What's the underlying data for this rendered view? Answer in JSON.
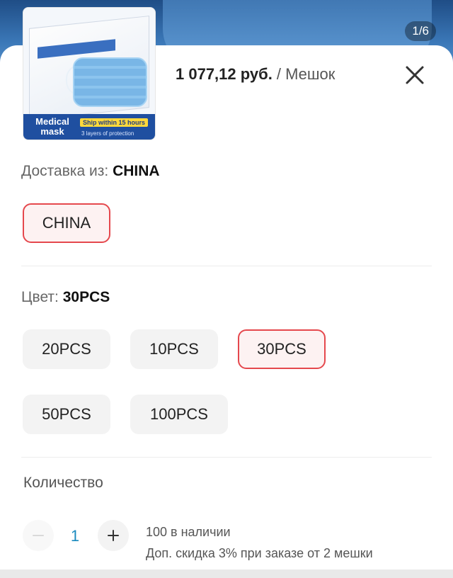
{
  "gallery": {
    "counter": "1/6"
  },
  "product": {
    "thumbnail": {
      "box_text": "一次性使用医用口罩",
      "medical_mask": "Medical mask",
      "ship_badge": "Ship within 15 hours",
      "layers": "3 layers of protection"
    },
    "price": "1 077,12 руб.",
    "unit": "/ Мешок"
  },
  "delivery": {
    "label": "Доставка из:",
    "selected": "CHINA",
    "options": [
      "CHINA"
    ]
  },
  "color": {
    "label": "Цвет:",
    "selected": "30PCS",
    "options": [
      "20PCS",
      "10PCS",
      "30PCS",
      "50PCS",
      "100PCS"
    ]
  },
  "quantity": {
    "label": "Количество",
    "value": "1",
    "stock": "100 в наличии",
    "discount": "Доп. скидка 3% при заказе от 2 мешки"
  },
  "colors": {
    "accent": "#e5484d",
    "qty_blue": "#1a8abf"
  }
}
